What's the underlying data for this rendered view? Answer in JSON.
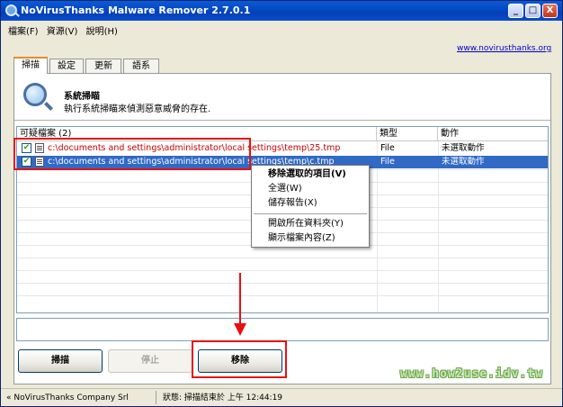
{
  "window": {
    "title": "NoVirusThanks Malware Remover 2.7.0.1",
    "minimize_glyph": "_",
    "maximize_glyph": "□",
    "close_glyph": "X"
  },
  "menu": [
    "檔案(F)",
    "資源(V)",
    "說明(H)"
  ],
  "top_link": "www.novirusthanks.org",
  "tabs": [
    "掃描",
    "設定",
    "更新",
    "語系"
  ],
  "header": {
    "title": "系統掃瞄",
    "description": "執行系統掃瞄來偵測惡意威脅的存在."
  },
  "list": {
    "columns": [
      "可疑檔案 (2)",
      "類型",
      "動作"
    ],
    "rows": [
      {
        "checked": true,
        "path": "c:\\documents and settings\\administrator\\local settings\\temp\\25.tmp",
        "type": "File",
        "action": "未選取動作",
        "selected": false
      },
      {
        "checked": true,
        "path": "c:\\documents and settings\\administrator\\local settings\\temp\\c.tmp",
        "type": "File",
        "action": "未選取動作",
        "selected": true
      }
    ]
  },
  "context_menu": {
    "items": [
      "移除選取的項目(V)",
      "全選(W)",
      "儲存報告(X)",
      "開啟所在資料夾(Y)",
      "顯示檔案內容(Z)"
    ]
  },
  "buttons": {
    "scan": "掃描",
    "stop": "停止",
    "remove": "移除"
  },
  "watermark": "www.how2use.idv.tw",
  "statusbar": {
    "left": "« NoVirusThanks Company Srl",
    "right": "狀態: 掃描結束於 上午 12:44:19"
  },
  "colors": {
    "title_bar": "#0a4ccc",
    "selection": "#316ac5",
    "highlight_box": "#e81010",
    "tab_accent": "#e68b2c"
  },
  "icons": [
    "app-magnifier-icon",
    "scan-magnifier-icon",
    "checkbox-check-icon",
    "file-icon"
  ]
}
